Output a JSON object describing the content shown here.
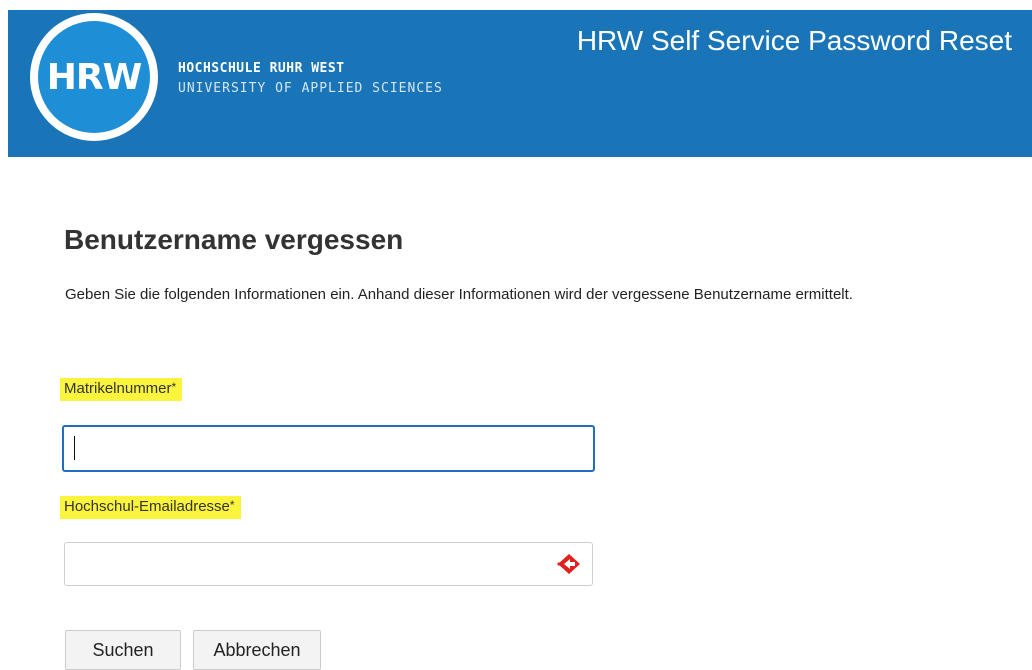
{
  "header": {
    "logo_text": "HRW",
    "university_name": "HOCHSCHULE RUHR WEST",
    "university_subtitle": "UNIVERSITY OF APPLIED SCIENCES",
    "app_title": "HRW Self Service Password Reset",
    "background_color": "#1a75b8"
  },
  "main": {
    "title": "Benutzername vergessen",
    "intro": "Geben Sie die folgenden Informationen ein. Anhand dieser Informationen wird der vergessene Benutzername ermittelt."
  },
  "form": {
    "matrikel": {
      "label": "Matrikelnummer",
      "required_marker": "*",
      "value": "",
      "placeholder": ""
    },
    "email": {
      "label": "Hochschul-Emailadresse",
      "required_marker": "*",
      "value": "",
      "placeholder": "",
      "autofill_icon": "autofill-icon"
    },
    "highlight_color": "#fbf43c"
  },
  "buttons": {
    "search": "Suchen",
    "cancel": "Abbrechen"
  }
}
